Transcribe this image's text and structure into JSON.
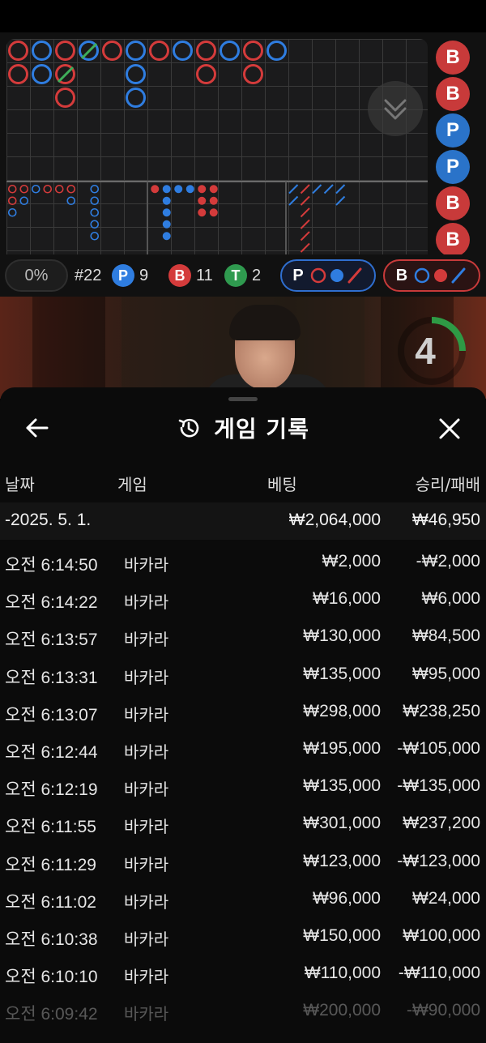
{
  "roadmap": {
    "side_badges": [
      {
        "letter": "B",
        "type": "b"
      },
      {
        "letter": "B",
        "type": "b"
      },
      {
        "letter": "P",
        "type": "p"
      },
      {
        "letter": "P",
        "type": "p"
      },
      {
        "letter": "B",
        "type": "b"
      },
      {
        "letter": "B",
        "type": "b"
      }
    ],
    "colors": {
      "player": "#2f7de0",
      "banker": "#d43b3b",
      "tie": "#2f9a4f",
      "tie_line": "#3fae5a"
    }
  },
  "stats": {
    "percent": "0%",
    "round": "#22",
    "player_letter": "P",
    "player_count": "9",
    "banker_letter": "B",
    "banker_count": "11",
    "tie_letter": "T",
    "tie_count": "2",
    "player_predict_letter": "P",
    "banker_predict_letter": "B"
  },
  "video": {
    "timer": "4"
  },
  "history": {
    "title": "게임 기록",
    "columns": {
      "date": "날짜",
      "game": "게임",
      "bet": "베팅",
      "win_loss": "승리/패배"
    },
    "date_row": {
      "date": "-2025. 5. 1.",
      "bet": "₩2,064,000",
      "win_loss": "₩46,950"
    },
    "rows": [
      {
        "time": "오전 6:14:50",
        "game": "바카라",
        "bet": "₩2,000",
        "win_loss": "-₩2,000"
      },
      {
        "time": "오전 6:14:22",
        "game": "바카라",
        "bet": "₩16,000",
        "win_loss": "₩6,000"
      },
      {
        "time": "오전 6:13:57",
        "game": "바카라",
        "bet": "₩130,000",
        "win_loss": "₩84,500"
      },
      {
        "time": "오전 6:13:31",
        "game": "바카라",
        "bet": "₩135,000",
        "win_loss": "₩95,000"
      },
      {
        "time": "오전 6:13:07",
        "game": "바카라",
        "bet": "₩298,000",
        "win_loss": "₩238,250"
      },
      {
        "time": "오전 6:12:44",
        "game": "바카라",
        "bet": "₩195,000",
        "win_loss": "-₩105,000"
      },
      {
        "time": "오전 6:12:19",
        "game": "바카라",
        "bet": "₩135,000",
        "win_loss": "-₩135,000"
      },
      {
        "time": "오전 6:11:55",
        "game": "바카라",
        "bet": "₩301,000",
        "win_loss": "₩237,200"
      },
      {
        "time": "오전 6:11:29",
        "game": "바카라",
        "bet": "₩123,000",
        "win_loss": "-₩123,000"
      },
      {
        "time": "오전 6:11:02",
        "game": "바카라",
        "bet": "₩96,000",
        "win_loss": "₩24,000"
      },
      {
        "time": "오전 6:10:38",
        "game": "바카라",
        "bet": "₩150,000",
        "win_loss": "₩100,000"
      },
      {
        "time": "오전 6:10:10",
        "game": "바카라",
        "bet": "₩110,000",
        "win_loss": "-₩110,000"
      },
      {
        "time": "오전 6:09:42",
        "game": "바카라",
        "bet": "₩200,000",
        "win_loss": "-₩90,000"
      }
    ]
  }
}
